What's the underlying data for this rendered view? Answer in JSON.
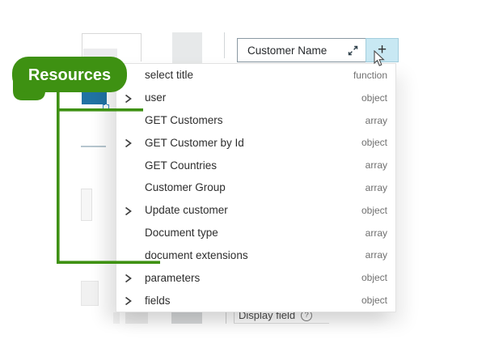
{
  "annotation": {
    "label": "Resources",
    "color": "#3e9112"
  },
  "field_bar": {
    "value": "Customer Name",
    "add_label": "+"
  },
  "dropdown": {
    "items": [
      {
        "label": "select title",
        "type": "function",
        "expandable": false
      },
      {
        "label": "user",
        "type": "object",
        "expandable": true
      },
      {
        "label": "GET Customers",
        "type": "array",
        "expandable": false
      },
      {
        "label": "GET Customer by Id",
        "type": "object",
        "expandable": true
      },
      {
        "label": "GET Countries",
        "type": "array",
        "expandable": false
      },
      {
        "label": "Customer Group",
        "type": "array",
        "expandable": false
      },
      {
        "label": "Update customer",
        "type": "object",
        "expandable": true
      },
      {
        "label": "Document type",
        "type": "array",
        "expandable": false
      },
      {
        "label": "document extensions",
        "type": "array",
        "expandable": false
      },
      {
        "label": "parameters",
        "type": "object",
        "expandable": true
      },
      {
        "label": "fields",
        "type": "object",
        "expandable": true
      }
    ]
  },
  "background": {
    "display_field_label": "Display field",
    "help_icon": "?"
  },
  "colors": {
    "annotation_green": "#3e9112",
    "accent_blue": "#2173a3",
    "add_button_bg": "#c8e8f3"
  }
}
